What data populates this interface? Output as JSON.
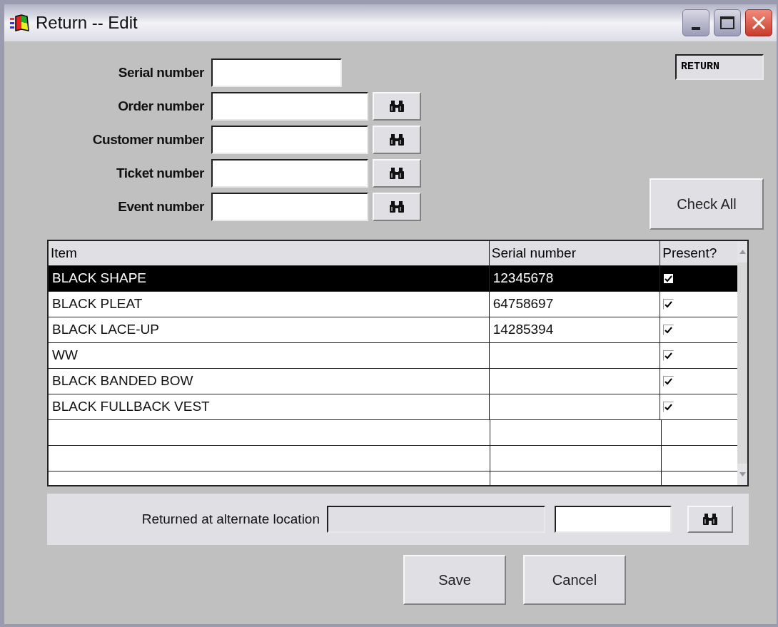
{
  "window": {
    "title": "Return -- Edit"
  },
  "mode_badge": "RETURN",
  "search_fields": [
    {
      "label": "Serial number",
      "lookup": false
    },
    {
      "label": "Order number",
      "lookup": true
    },
    {
      "label": "Customer number",
      "lookup": true
    },
    {
      "label": "Ticket number",
      "lookup": true
    },
    {
      "label": "Event number",
      "lookup": true
    }
  ],
  "check_all_button": "Check All",
  "table": {
    "columns": [
      "Item",
      "Serial number",
      "Present?"
    ],
    "rows": [
      {
        "item": "BLACK SHAPE",
        "serial": "12345678",
        "present": true,
        "selected": true
      },
      {
        "item": "BLACK PLEAT",
        "serial": "64758697",
        "present": true,
        "selected": false
      },
      {
        "item": "BLACK LACE-UP",
        "serial": "14285394",
        "present": true,
        "selected": false
      },
      {
        "item": "WW",
        "present": true,
        "selected": false
      },
      {
        "item": "BLACK BANDED BOW",
        "present": true,
        "selected": false
      },
      {
        "item": "BLACK FULLBACK VEST",
        "present": true,
        "selected": false
      }
    ]
  },
  "alternate_location": {
    "label": "Returned at alternate location"
  },
  "buttons": [
    "Save",
    "Cancel"
  ]
}
